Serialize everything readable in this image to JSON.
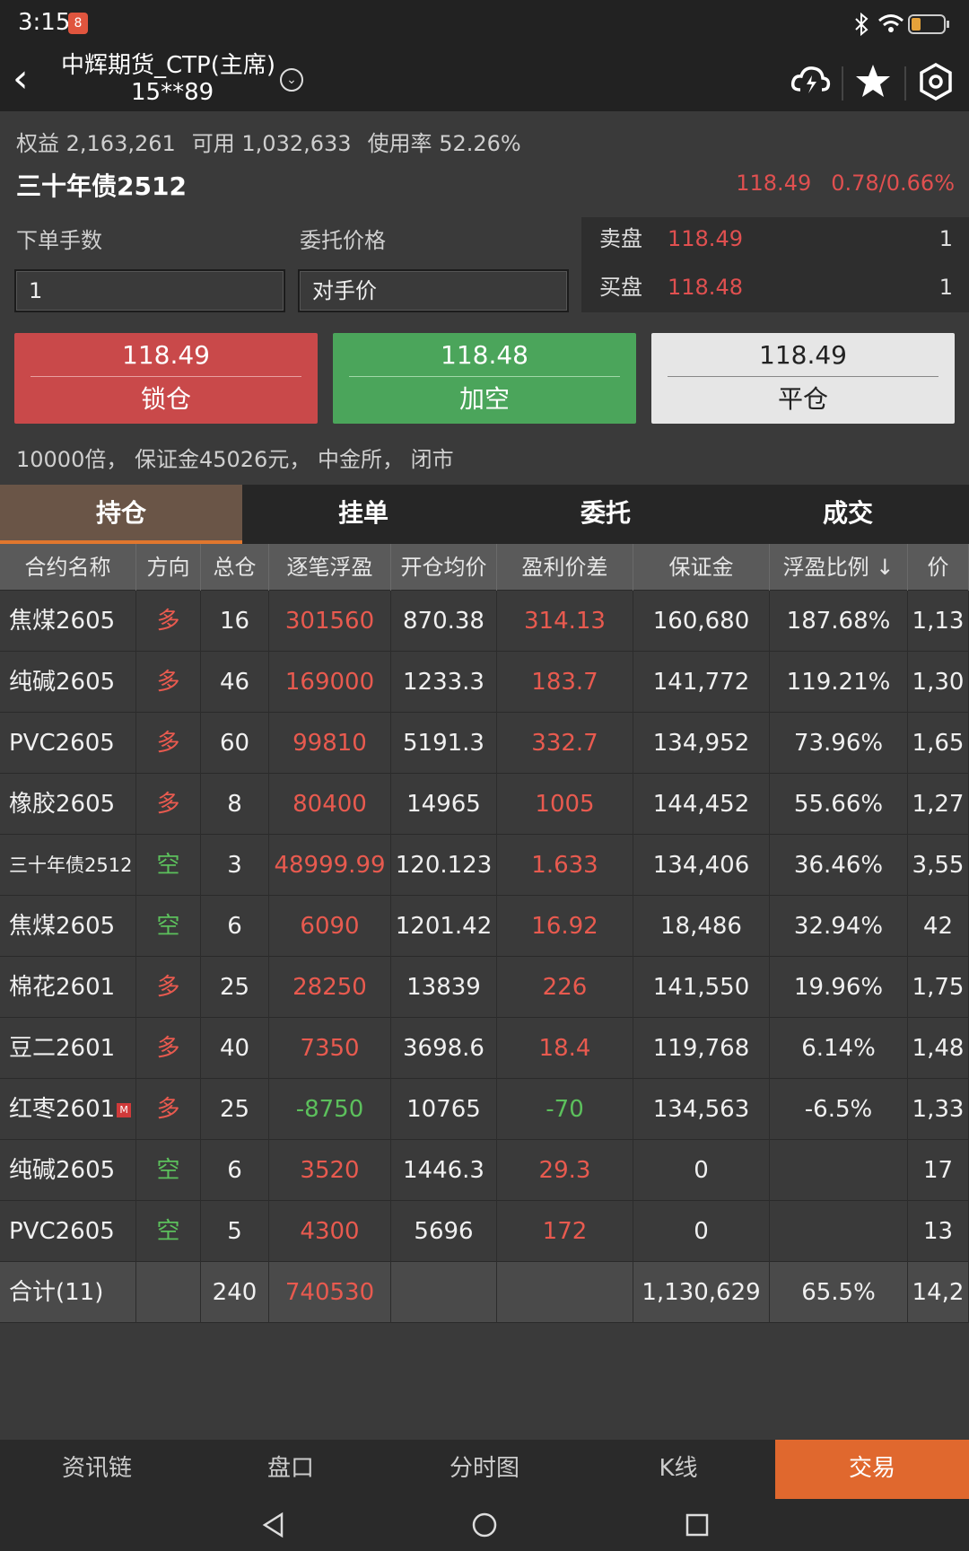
{
  "status": {
    "time": "3:15",
    "note_icon": "8"
  },
  "header": {
    "title": "中辉期货_CTP(主席)",
    "account": "15**89"
  },
  "account": {
    "equity": "权益 2,163,261",
    "available": "可用 1,032,633",
    "usage": "使用率 52.26%"
  },
  "instrument": {
    "name": "三十年债2512",
    "price": "118.49",
    "change": "0.78/0.66%"
  },
  "order": {
    "qty_label": "下单手数",
    "qty_value": "1",
    "price_label": "委托价格",
    "price_value": "对手价"
  },
  "orderbook": {
    "ask_label": "卖盘",
    "ask_price": "118.49",
    "ask_qty": "1",
    "bid_label": "买盘",
    "bid_price": "118.48",
    "bid_qty": "1"
  },
  "buttons": {
    "lock": {
      "price": "118.49",
      "label": "锁仓"
    },
    "short": {
      "price": "118.48",
      "label": "加空"
    },
    "close": {
      "price": "118.49",
      "label": "平仓"
    }
  },
  "info": "10000倍， 保证金45026元， 中金所， 闭市",
  "tabs": [
    "持仓",
    "挂单",
    "委托",
    "成交"
  ],
  "table": {
    "headers": [
      "合约名称",
      "方向",
      "总仓",
      "逐笔浮盈",
      "开仓均价",
      "盈利价差",
      "保证金",
      "浮盈比例 ↓",
      "价"
    ],
    "rows": [
      [
        "焦煤2605",
        "多",
        "16",
        "301560",
        "870.38",
        "314.13",
        "160,680",
        "187.68%",
        "1,13"
      ],
      [
        "纯碱2605",
        "多",
        "46",
        "169000",
        "1233.3",
        "183.7",
        "141,772",
        "119.21%",
        "1,30"
      ],
      [
        "PVC2605",
        "多",
        "60",
        "99810",
        "5191.3",
        "332.7",
        "134,952",
        "73.96%",
        "1,65"
      ],
      [
        "橡胶2605",
        "多",
        "8",
        "80400",
        "14965",
        "1005",
        "144,452",
        "55.66%",
        "1,27"
      ],
      [
        "三十年债2512",
        "空",
        "3",
        "48999.99",
        "120.123",
        "1.633",
        "134,406",
        "36.46%",
        "3,55"
      ],
      [
        "焦煤2605",
        "空",
        "6",
        "6090",
        "1201.42",
        "16.92",
        "18,486",
        "32.94%",
        "42"
      ],
      [
        "棉花2601",
        "多",
        "25",
        "28250",
        "13839",
        "226",
        "141,550",
        "19.96%",
        "1,75"
      ],
      [
        "豆二2601",
        "多",
        "40",
        "7350",
        "3698.6",
        "18.4",
        "119,768",
        "6.14%",
        "1,48"
      ],
      [
        "红枣2601",
        "多",
        "25",
        "-8750",
        "10765",
        "-70",
        "134,563",
        "-6.5%",
        "1,33"
      ],
      [
        "纯碱2605",
        "空",
        "6",
        "3520",
        "1446.3",
        "29.3",
        "0",
        "",
        "17"
      ],
      [
        "PVC2605",
        "空",
        "5",
        "4300",
        "5696",
        "172",
        "0",
        "",
        "13"
      ]
    ],
    "total": [
      "合计(11)",
      "",
      "240",
      "740530",
      "",
      "",
      "1,130,629",
      "65.5%",
      "14,2"
    ],
    "badge": "M"
  },
  "nav": [
    "资讯链",
    "盘口",
    "分时图",
    "K线",
    "交易"
  ],
  "colors": {
    "up": "#e85a4f",
    "down": "#5cc05c",
    "accent": "#e0682e",
    "buy": "#c9494a",
    "sell": "#4ba55b"
  }
}
